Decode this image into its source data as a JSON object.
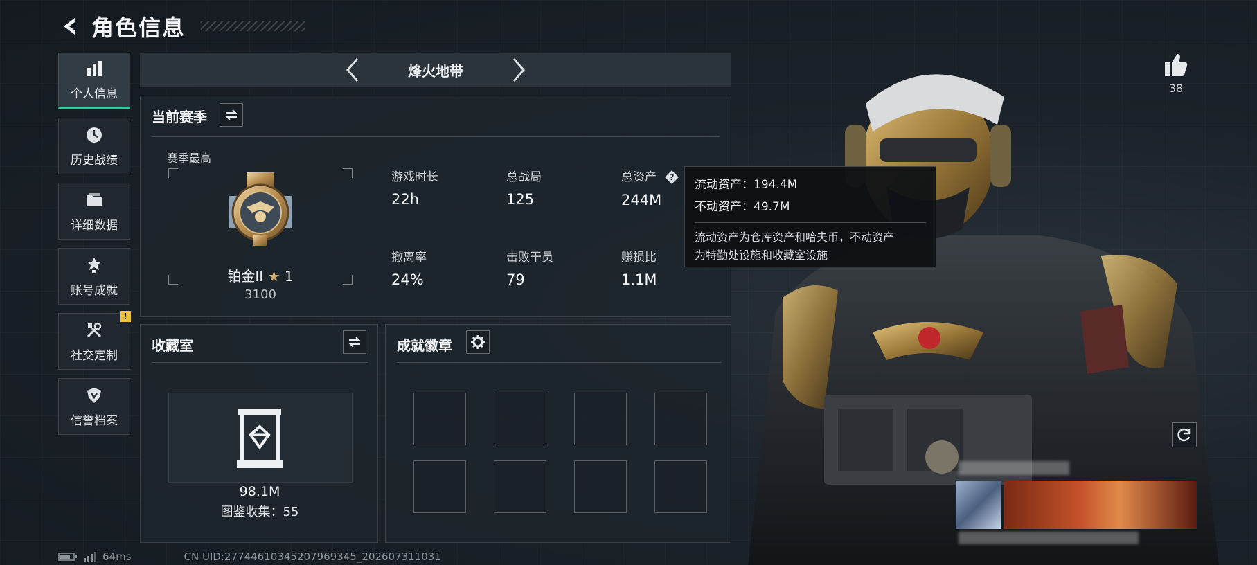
{
  "header": {
    "title": "角色信息"
  },
  "nav": {
    "items": [
      {
        "label": "个人信息",
        "icon": "bar-chart-icon",
        "active": true
      },
      {
        "label": "历史战绩",
        "icon": "clock-icon"
      },
      {
        "label": "详细数据",
        "icon": "folder-icon"
      },
      {
        "label": "账号成就",
        "icon": "achievement-icon"
      },
      {
        "label": "社交定制",
        "icon": "tools-icon",
        "badge": "!"
      },
      {
        "label": "信誉档案",
        "icon": "shield-icon"
      }
    ]
  },
  "mode": {
    "title": "烽火地带"
  },
  "season": {
    "title": "当前赛季",
    "best_label": "赛季最高",
    "rank_name": "铂金II",
    "rank_stars": "1",
    "rank_score": "3100",
    "stats": [
      {
        "label": "游戏时长",
        "value": "22h"
      },
      {
        "label": "总战局",
        "value": "125"
      },
      {
        "label": "总资产",
        "value": "244M"
      },
      {
        "label": "撤离率",
        "value": "24%"
      },
      {
        "label": "击败干员",
        "value": "79"
      },
      {
        "label": "赚损比",
        "value": "1.1M"
      }
    ]
  },
  "tooltip": {
    "liquid": "流动资产：194.4M",
    "fixed": "不动资产：49.7M",
    "desc_line1": "流动资产为仓库资产和哈夫币，不动资产",
    "desc_line2": "为特勤处设施和收藏室设施"
  },
  "collection": {
    "title": "收藏室",
    "value": "98.1M",
    "count_text": "图鉴收集：55"
  },
  "achievements": {
    "title": "成就徽章"
  },
  "character": {
    "likes": "38"
  },
  "footer": {
    "ping": "64ms",
    "uid": "CN UID:27744610345207969345_202607311031"
  },
  "colors": {
    "accent": "#3fc39a",
    "badge": "#e8c33a"
  }
}
